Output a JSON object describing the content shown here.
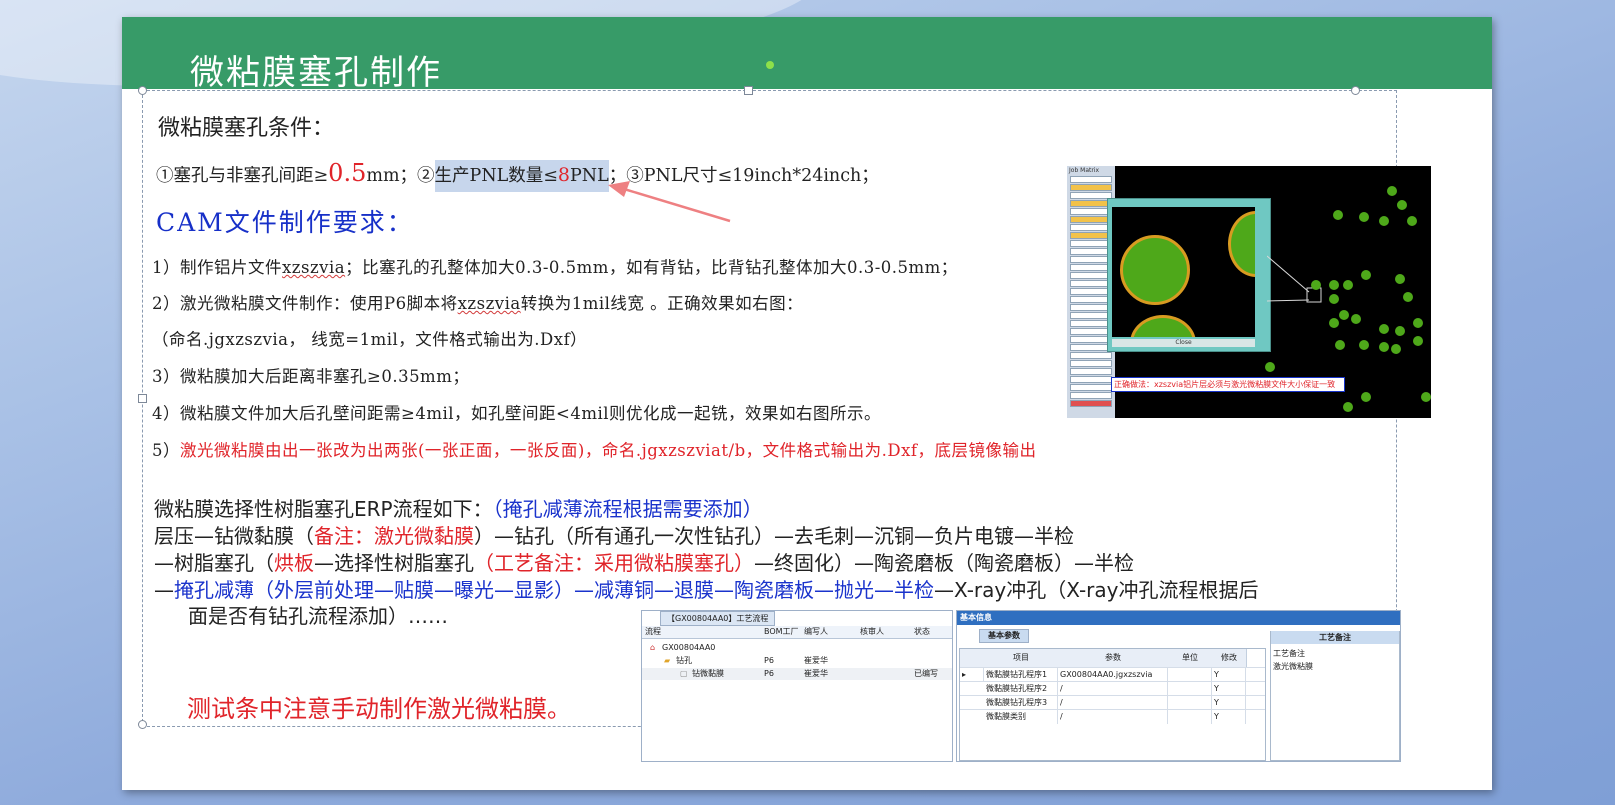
{
  "slide": {
    "title": "微粘膜塞孔制作",
    "condition_heading": "微粘膜塞孔条件：",
    "conditions": {
      "c1_prefix": "①塞孔与非塞孔间距≥",
      "c1_value": "0.5",
      "c1_unit": "mm；②",
      "c2_prefix": "生产PNL数量≤",
      "c2_value": "8",
      "c2_unit": "PNL",
      "c3": "；③PNL尺寸≤19inch*24inch；"
    },
    "cam_heading": "CAM文件制作要求：",
    "req": {
      "r1_a": "1）制作铝片文件",
      "r1_file": "xzszvia",
      "r1_b": "；比塞孔的孔整体加大0.3-0.5mm，如有背钻，比背钻孔整体加大0.3-0.5mm；",
      "r2_a": "2）激光微粘膜文件制作：使用P6脚本将",
      "r2_file": "xzszvia",
      "r2_b": "转换为1mil线宽 。正确效果如右图：",
      "r2_note": "（命名.jgxzszvia， 线宽=1mil，文件格式输出为.Dxf）",
      "r3": "3）微粘膜加大后距离非塞孔≥0.35mm；",
      "r4": "4）微粘膜文件加大后孔壁间距需≥4mil，如孔壁间距<4mil则优化成一起铣，效果如右图所示。",
      "r5_a": "5）",
      "r5_b": "激光微粘膜由出一张改为出两张(一张正面，一张反面)，命名.jgxzszviat/b，文件格式输出为.Dxf，底层镜像输出"
    },
    "flow": {
      "heading": "微粘膜选择性树脂塞孔ERP流程如下：",
      "heading_note": "（掩孔减薄流程根据需要添加）",
      "l1_a": "层压—钻微黏膜（",
      "l1_red": "备注：激光微黏膜",
      "l1_b": "）—钻孔（所有通孔一次性钻孔）—去毛刺—沉铜—负片电镀—半检",
      "l2_a": "—树脂塞孔（",
      "l2_red1": "烘板",
      "l2_b": "—选择性树脂塞孔",
      "l2_red2": "（工艺备注：采用微粘膜塞孔）",
      "l2_c": "—终固化）—陶瓷磨板（陶瓷磨板）—半检",
      "l3_a": "—",
      "l3_blue": "掩孔减薄（外层前处理—贴膜—曝光—显影）—减薄铜—退膜—陶瓷磨板—抛光—半检",
      "l3_b": "—X-ray冲孔（X-ray冲孔流程根据后",
      "l4": "面是否有钻孔流程添加）……"
    },
    "bottom_note": "测试条中注意手动制作激光微粘膜。"
  },
  "cam_image": {
    "window_footer": "Close",
    "note": "正确做法：xzszvia铝片层必须与激光微粘膜文件大小保证一致",
    "sidebar_title": "Job Matrix"
  },
  "erp": {
    "tab": "【GX00804AA0】工艺流程",
    "tree_headers": [
      "流程",
      "BOM工厂",
      "编写人",
      "核审人",
      "状态"
    ],
    "tree_rows": [
      {
        "name": "GX00804AA0",
        "factory": "",
        "writer": "",
        "reviewer": "",
        "status": ""
      },
      {
        "name": "钻孔",
        "factory": "P6",
        "writer": "崔爱华",
        "reviewer": "",
        "status": ""
      },
      {
        "name": "钻微黏膜",
        "factory": "P6",
        "writer": "崔爱华",
        "reviewer": "",
        "status": "已编写"
      }
    ],
    "right_title": "基本信息",
    "sub_tab": "基本参数",
    "grid_headers": [
      "项目",
      "参数",
      "单位",
      "修改"
    ],
    "grid_rows": [
      {
        "item": "微黏膜钻孔程序1",
        "param": "GX00804AA0.jgxzszvia",
        "unit": "",
        "edit": "Y"
      },
      {
        "item": "微黏膜钻孔程序2",
        "param": "/",
        "unit": "",
        "edit": "Y"
      },
      {
        "item": "微黏膜钻孔程序3",
        "param": "/",
        "unit": "",
        "edit": "Y"
      },
      {
        "item": "微黏膜类别",
        "param": "/",
        "unit": "",
        "edit": "Y"
      }
    ],
    "note_tab": "工艺备注",
    "note_header": "工艺备注",
    "note_value": "激光微粘膜"
  }
}
